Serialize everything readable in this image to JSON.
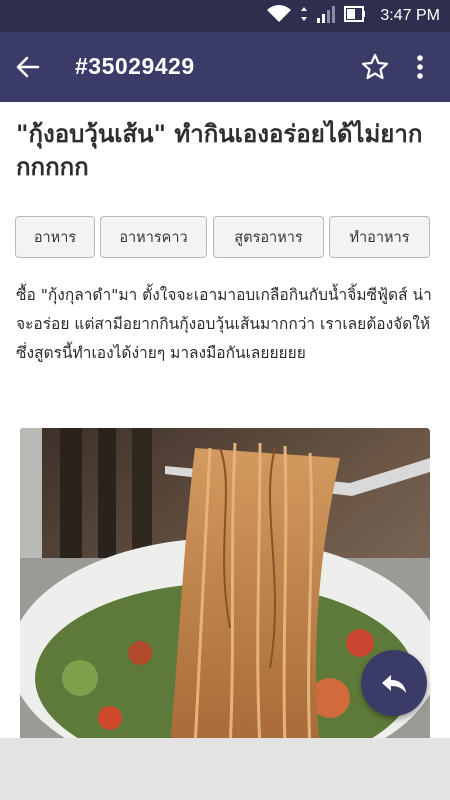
{
  "status_bar": {
    "time": "3:47 PM",
    "icons": [
      "wifi-icon",
      "cell-signal-icon",
      "battery-icon"
    ]
  },
  "app_bar": {
    "title": "#35029429",
    "icons": [
      "back-arrow-icon",
      "star-outline-icon",
      "more-vert-icon"
    ]
  },
  "article": {
    "title": "\"กุ้งอบวุ้นเส้น\" ทำกินเองอร่อยได้ไม่ยากกกกกก",
    "tags": [
      {
        "label": "อาหาร"
      },
      {
        "label": "อาหารคาว"
      },
      {
        "label": "สูตรอาหาร"
      },
      {
        "label": "ทำอาหาร"
      }
    ],
    "body": "ซื้อ \"กุ้งกุลาดำ\"มา ตั้งใจจะเอามาอบเกลือกินกับน้ำจิ้มซีฟู้ดส์ น่าจะอร่อย แต่สามีอยากกินกุ้งอบวุ้นเส้นมากกว่า เราเลยต้องจัดให้ ซึ่งสูตรนี้ทำเองได้ง่ายๆ มาลงมือกันเลยยยยย",
    "image": "glass-noodles-on-fork-photo"
  },
  "fab": {
    "icon": "reply-icon"
  },
  "colors": {
    "status_bar": "#2e2f4f",
    "app_bar": "#3a3b66",
    "tag_border": "#b9b9b9",
    "tag_bg": "#f3f3f3",
    "text": "#2b2b2b",
    "bottom_panel": "#e3e3e3"
  }
}
